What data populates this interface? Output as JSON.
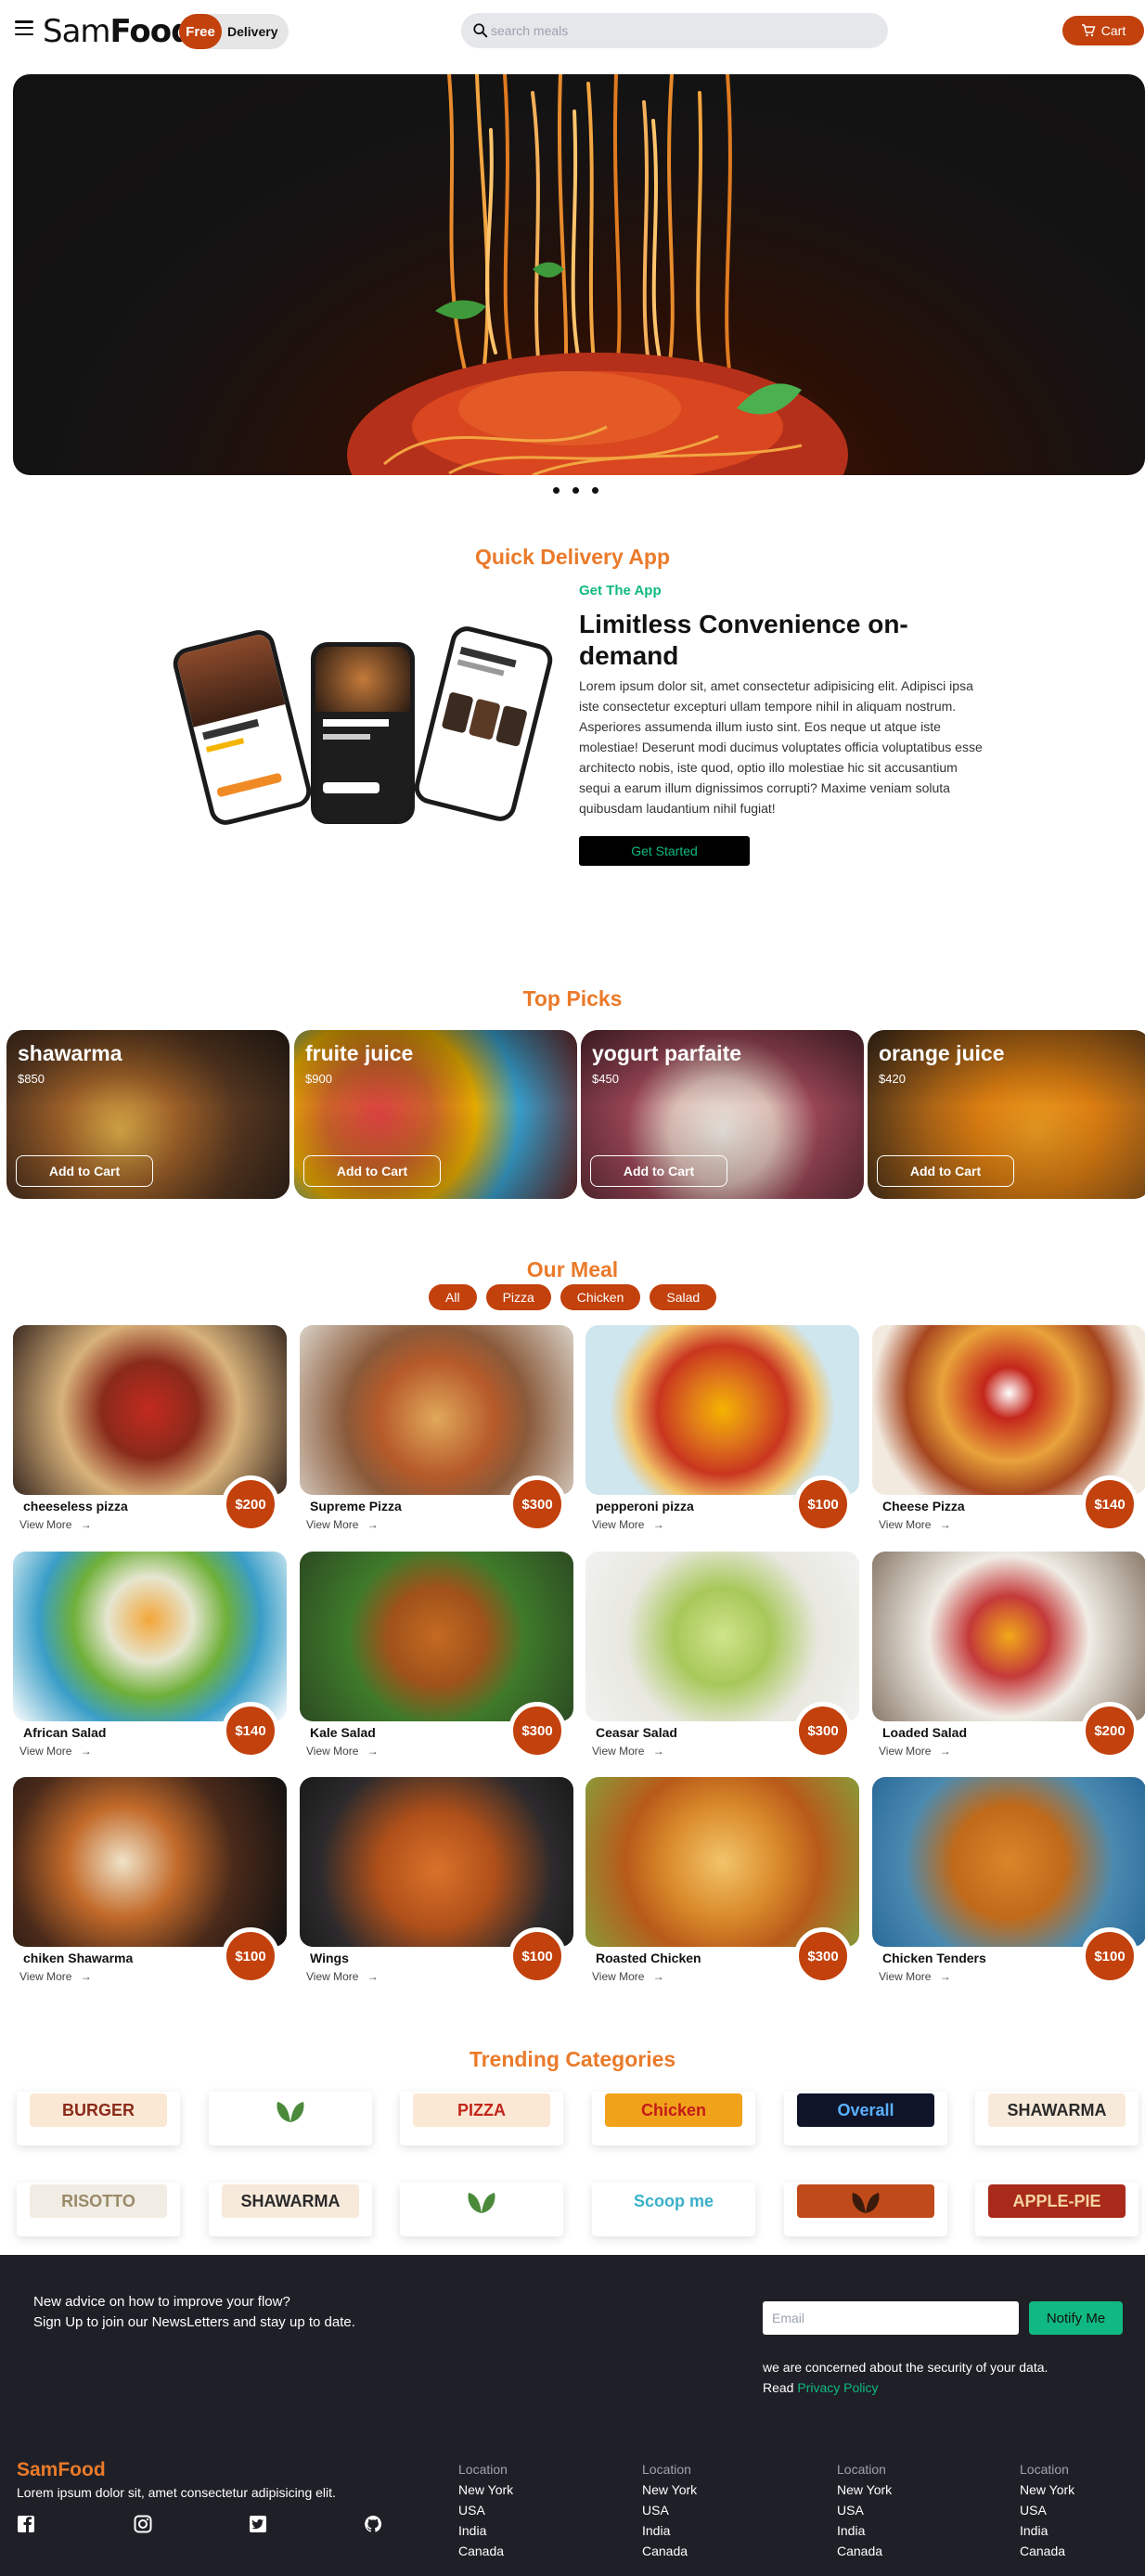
{
  "nav": {
    "brand_light": "Sam",
    "brand_bold": "Food",
    "free_label": "Free",
    "delivery_label": "Delivery",
    "search_placeholder": "search meals",
    "cart_label": "Cart"
  },
  "hero": {
    "slide_count": 3
  },
  "app_section": {
    "title": "Quick Delivery App",
    "subtitle": "Get The App",
    "heading": "Limitless Convenience on-demand",
    "text": "Lorem ipsum dolor sit, amet consectetur adipisicing elit. Adipisci ipsa iste consectetur excepturi ullam tempore nihil in aliquam nostrum. Asperiores assumenda illum iusto sint. Eos neque ut atque iste molestiae! Deserunt modi ducimus voluptates officia voluptatibus esse architecto nobis, iste quod, optio illo molestiae hic sit accusantium sequi a earum illum dignissimos corrupti? Maxime veniam soluta quibusdam laudantium nihil fugiat!",
    "button": "Get Started"
  },
  "top_picks": {
    "title": "Top Picks",
    "items": [
      {
        "name": "shawarma",
        "price": "$850",
        "button": "Add to Cart"
      },
      {
        "name": "fruite juice",
        "price": "$900",
        "button": "Add to Cart"
      },
      {
        "name": "yogurt parfaite",
        "price": "$450",
        "button": "Add to Cart"
      },
      {
        "name": "orange juice",
        "price": "$420",
        "button": "Add to Cart"
      }
    ]
  },
  "our_meal": {
    "title": "Our Meal",
    "filters": [
      "All",
      "Pizza",
      "Chicken",
      "Salad"
    ],
    "view_more": "View More",
    "items": [
      {
        "name": "cheeseless pizza",
        "price": "$200"
      },
      {
        "name": "Supreme Pizza",
        "price": "$300"
      },
      {
        "name": "pepperoni pizza",
        "price": "$100"
      },
      {
        "name": "Cheese Pizza",
        "price": "$140"
      },
      {
        "name": "African Salad",
        "price": "$140"
      },
      {
        "name": "Kale Salad",
        "price": "$300"
      },
      {
        "name": "Ceasar Salad",
        "price": "$300"
      },
      {
        "name": "Loaded Salad",
        "price": "$200"
      },
      {
        "name": "chiken Shawarma",
        "price": "$100"
      },
      {
        "name": "Wings",
        "price": "$100"
      },
      {
        "name": "Roasted Chicken",
        "price": "$300"
      },
      {
        "name": "Chicken Tenders",
        "price": "$100"
      }
    ]
  },
  "trending": {
    "title": "Trending Categories",
    "logos": [
      "BURGER",
      "",
      "PIZZA",
      "Chicken",
      "Overall",
      "SHAWARMA",
      "RISOTTO",
      "SHAWARMA",
      "",
      "Scoop me",
      "",
      "APPLE-PIE"
    ]
  },
  "footer": {
    "newsletter_line1": "New advice on how to improve your flow?",
    "newsletter_line2": "Sign Up to join our NewsLetters and stay up to date.",
    "email_placeholder": "Email",
    "notify_button": "Notify Me",
    "security_note": "we are concerned about the security of your data.",
    "read": "Read",
    "privacy_link": "Privacy Policy",
    "brand": "SamFood",
    "description": "Lorem ipsum dolor sit, amet consectetur adipisicing elit.",
    "columns": [
      {
        "heading": "Location",
        "items": [
          "New York",
          "USA",
          "India",
          "Canada"
        ]
      },
      {
        "heading": "Location",
        "items": [
          "New York",
          "USA",
          "India",
          "Canada"
        ]
      },
      {
        "heading": "Location",
        "items": [
          "New York",
          "USA",
          "India",
          "Canada"
        ]
      },
      {
        "heading": "Location",
        "items": [
          "New York",
          "USA",
          "India",
          "Canada"
        ]
      }
    ]
  },
  "colors": {
    "accent": "#c2410c",
    "heading_orange": "#ea7a2a",
    "green": "#10b981",
    "footer_bg": "#1f2027"
  }
}
